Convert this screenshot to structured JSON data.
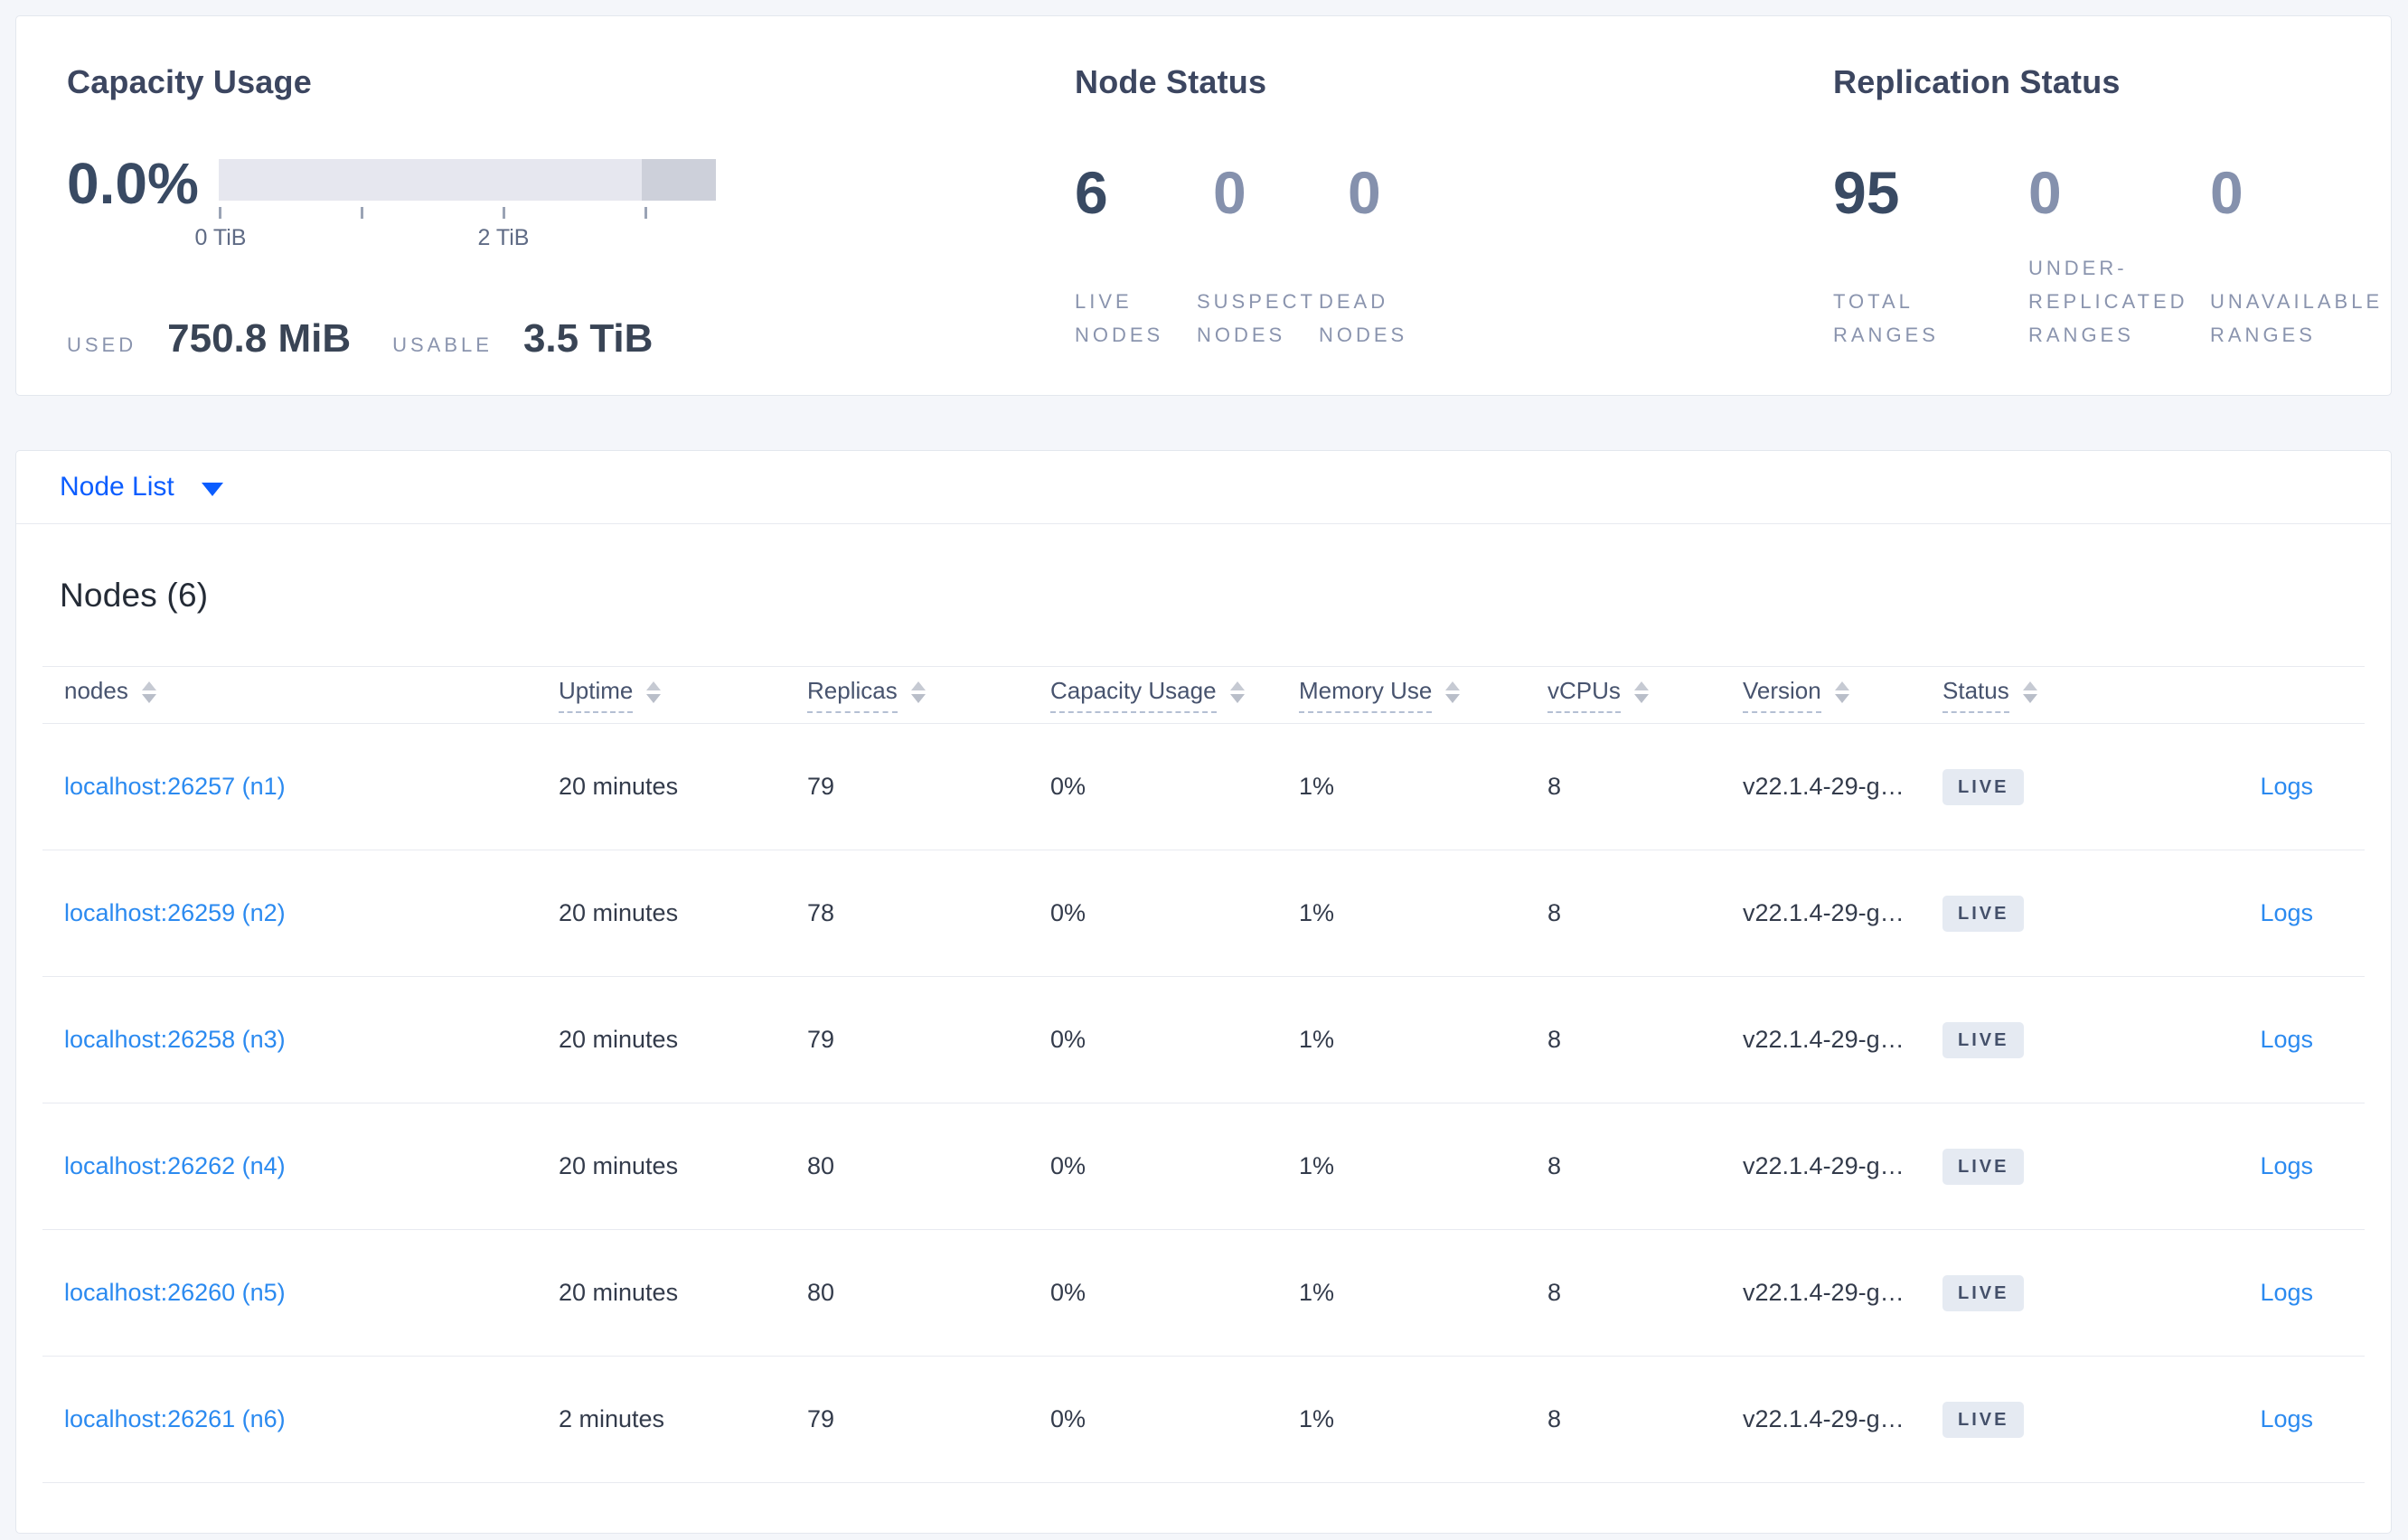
{
  "summary": {
    "capacity": {
      "title": "Capacity Usage",
      "percent": "0.0%",
      "tick_labels": [
        "0 TiB",
        "2 TiB"
      ],
      "used_label": "USED",
      "used_value": "750.8 MiB",
      "usable_label": "USABLE",
      "usable_value": "3.5 TiB"
    },
    "node_status": {
      "title": "Node Status",
      "stats": [
        {
          "value": "6",
          "label": "LIVE NODES"
        },
        {
          "value": "0",
          "label": "SUSPECT NODES"
        },
        {
          "value": "0",
          "label": "DEAD NODES"
        }
      ]
    },
    "replication": {
      "title": "Replication Status",
      "stats": [
        {
          "value": "95",
          "label": "TOTAL RANGES"
        },
        {
          "value": "0",
          "label": "UNDER-REPLICATED RANGES"
        },
        {
          "value": "0",
          "label": "UNAVAILABLE RANGES"
        }
      ]
    }
  },
  "node_list": {
    "dropdown_label": "Node List",
    "heading": "Nodes (6)",
    "columns": [
      "nodes",
      "Uptime",
      "Replicas",
      "Capacity Usage",
      "Memory Use",
      "vCPUs",
      "Version",
      "Status"
    ],
    "rows": [
      {
        "node": "localhost:26257 (n1)",
        "uptime": "20 minutes",
        "replicas": "79",
        "capacity": "0%",
        "memory": "1%",
        "vcpus": "8",
        "version": "v22.1.4-29-g…",
        "status": "LIVE",
        "logs": "Logs"
      },
      {
        "node": "localhost:26259 (n2)",
        "uptime": "20 minutes",
        "replicas": "78",
        "capacity": "0%",
        "memory": "1%",
        "vcpus": "8",
        "version": "v22.1.4-29-g…",
        "status": "LIVE",
        "logs": "Logs"
      },
      {
        "node": "localhost:26258 (n3)",
        "uptime": "20 minutes",
        "replicas": "79",
        "capacity": "0%",
        "memory": "1%",
        "vcpus": "8",
        "version": "v22.1.4-29-g…",
        "status": "LIVE",
        "logs": "Logs"
      },
      {
        "node": "localhost:26262 (n4)",
        "uptime": "20 minutes",
        "replicas": "80",
        "capacity": "0%",
        "memory": "1%",
        "vcpus": "8",
        "version": "v22.1.4-29-g…",
        "status": "LIVE",
        "logs": "Logs"
      },
      {
        "node": "localhost:26260 (n5)",
        "uptime": "20 minutes",
        "replicas": "80",
        "capacity": "0%",
        "memory": "1%",
        "vcpus": "8",
        "version": "v22.1.4-29-g…",
        "status": "LIVE",
        "logs": "Logs"
      },
      {
        "node": "localhost:26261 (n6)",
        "uptime": "2 minutes",
        "replicas": "79",
        "capacity": "0%",
        "memory": "1%",
        "vcpus": "8",
        "version": "v22.1.4-29-g…",
        "status": "LIVE",
        "logs": "Logs"
      }
    ]
  }
}
